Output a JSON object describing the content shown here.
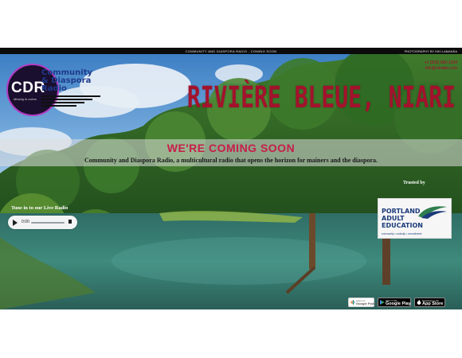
{
  "topbar": {
    "title": "COMMUNITY AND DIASPORA RADIO - COMING SOON",
    "credit": "PHOTOGRAPHY BY KIKI LAMANSA"
  },
  "logo": {
    "abbr": "CDR",
    "tagline": "Moving in colors",
    "name_line1": "Community",
    "name_line2": "& Diaspora",
    "name_line3": "Radio"
  },
  "contact": {
    "phone": "+1 (503) 555-1234",
    "email": "info@cdradio.com"
  },
  "hero": {
    "location_title": "RIVIÈRE BLEUE, NIARI",
    "coming_soon": "WE'RE COMING SOON",
    "description": "Community and Diaspora Radio, a multicultural radio that opens the horizon for mainers and the diaspora."
  },
  "radio": {
    "tune_in_label": "Tune in to our Live Radio",
    "time": "0:00"
  },
  "trusted": {
    "label": "Trusted by",
    "partner_line1": "PORTLAND",
    "partner_line2": "ADULT",
    "partner_line3": "EDUCATION",
    "partner_tagline": "community • curiosity • commitment"
  },
  "stores": {
    "podcasts_small": "Listen on",
    "podcasts_big": "Google Podcasts",
    "gplay_small": "GET IT ON",
    "gplay_big": "Google Play",
    "appstore_small": "Download on the",
    "appstore_big": "App Store"
  }
}
